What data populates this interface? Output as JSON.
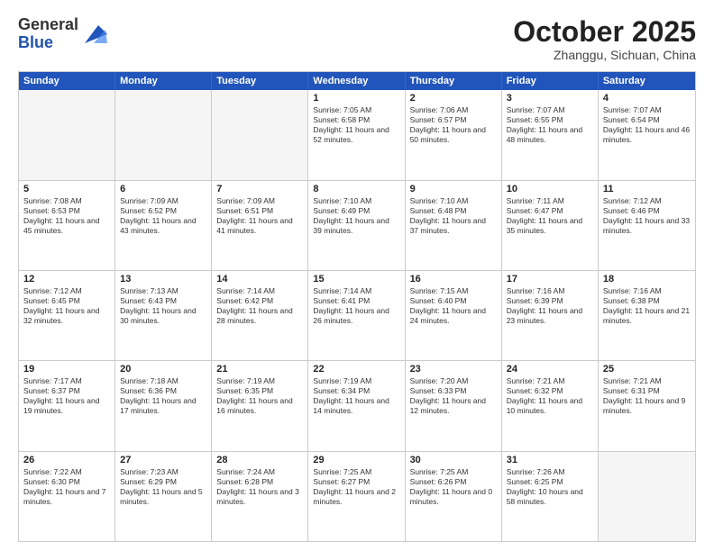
{
  "header": {
    "logo": {
      "general": "General",
      "blue": "Blue"
    },
    "title": "October 2025",
    "location": "Zhanggu, Sichuan, China"
  },
  "calendar": {
    "days_of_week": [
      "Sunday",
      "Monday",
      "Tuesday",
      "Wednesday",
      "Thursday",
      "Friday",
      "Saturday"
    ],
    "rows": [
      [
        {
          "day": "",
          "empty": true
        },
        {
          "day": "",
          "empty": true
        },
        {
          "day": "",
          "empty": true
        },
        {
          "day": "1",
          "sunrise": "7:05 AM",
          "sunset": "6:58 PM",
          "daylight": "11 hours and 52 minutes."
        },
        {
          "day": "2",
          "sunrise": "7:06 AM",
          "sunset": "6:57 PM",
          "daylight": "11 hours and 50 minutes."
        },
        {
          "day": "3",
          "sunrise": "7:07 AM",
          "sunset": "6:55 PM",
          "daylight": "11 hours and 48 minutes."
        },
        {
          "day": "4",
          "sunrise": "7:07 AM",
          "sunset": "6:54 PM",
          "daylight": "11 hours and 46 minutes."
        }
      ],
      [
        {
          "day": "5",
          "sunrise": "7:08 AM",
          "sunset": "6:53 PM",
          "daylight": "11 hours and 45 minutes."
        },
        {
          "day": "6",
          "sunrise": "7:09 AM",
          "sunset": "6:52 PM",
          "daylight": "11 hours and 43 minutes."
        },
        {
          "day": "7",
          "sunrise": "7:09 AM",
          "sunset": "6:51 PM",
          "daylight": "11 hours and 41 minutes."
        },
        {
          "day": "8",
          "sunrise": "7:10 AM",
          "sunset": "6:49 PM",
          "daylight": "11 hours and 39 minutes."
        },
        {
          "day": "9",
          "sunrise": "7:10 AM",
          "sunset": "6:48 PM",
          "daylight": "11 hours and 37 minutes."
        },
        {
          "day": "10",
          "sunrise": "7:11 AM",
          "sunset": "6:47 PM",
          "daylight": "11 hours and 35 minutes."
        },
        {
          "day": "11",
          "sunrise": "7:12 AM",
          "sunset": "6:46 PM",
          "daylight": "11 hours and 33 minutes."
        }
      ],
      [
        {
          "day": "12",
          "sunrise": "7:12 AM",
          "sunset": "6:45 PM",
          "daylight": "11 hours and 32 minutes."
        },
        {
          "day": "13",
          "sunrise": "7:13 AM",
          "sunset": "6:43 PM",
          "daylight": "11 hours and 30 minutes."
        },
        {
          "day": "14",
          "sunrise": "7:14 AM",
          "sunset": "6:42 PM",
          "daylight": "11 hours and 28 minutes."
        },
        {
          "day": "15",
          "sunrise": "7:14 AM",
          "sunset": "6:41 PM",
          "daylight": "11 hours and 26 minutes."
        },
        {
          "day": "16",
          "sunrise": "7:15 AM",
          "sunset": "6:40 PM",
          "daylight": "11 hours and 24 minutes."
        },
        {
          "day": "17",
          "sunrise": "7:16 AM",
          "sunset": "6:39 PM",
          "daylight": "11 hours and 23 minutes."
        },
        {
          "day": "18",
          "sunrise": "7:16 AM",
          "sunset": "6:38 PM",
          "daylight": "11 hours and 21 minutes."
        }
      ],
      [
        {
          "day": "19",
          "sunrise": "7:17 AM",
          "sunset": "6:37 PM",
          "daylight": "11 hours and 19 minutes."
        },
        {
          "day": "20",
          "sunrise": "7:18 AM",
          "sunset": "6:36 PM",
          "daylight": "11 hours and 17 minutes."
        },
        {
          "day": "21",
          "sunrise": "7:19 AM",
          "sunset": "6:35 PM",
          "daylight": "11 hours and 16 minutes."
        },
        {
          "day": "22",
          "sunrise": "7:19 AM",
          "sunset": "6:34 PM",
          "daylight": "11 hours and 14 minutes."
        },
        {
          "day": "23",
          "sunrise": "7:20 AM",
          "sunset": "6:33 PM",
          "daylight": "11 hours and 12 minutes."
        },
        {
          "day": "24",
          "sunrise": "7:21 AM",
          "sunset": "6:32 PM",
          "daylight": "11 hours and 10 minutes."
        },
        {
          "day": "25",
          "sunrise": "7:21 AM",
          "sunset": "6:31 PM",
          "daylight": "11 hours and 9 minutes."
        }
      ],
      [
        {
          "day": "26",
          "sunrise": "7:22 AM",
          "sunset": "6:30 PM",
          "daylight": "11 hours and 7 minutes."
        },
        {
          "day": "27",
          "sunrise": "7:23 AM",
          "sunset": "6:29 PM",
          "daylight": "11 hours and 5 minutes."
        },
        {
          "day": "28",
          "sunrise": "7:24 AM",
          "sunset": "6:28 PM",
          "daylight": "11 hours and 3 minutes."
        },
        {
          "day": "29",
          "sunrise": "7:25 AM",
          "sunset": "6:27 PM",
          "daylight": "11 hours and 2 minutes."
        },
        {
          "day": "30",
          "sunrise": "7:25 AM",
          "sunset": "6:26 PM",
          "daylight": "11 hours and 0 minutes."
        },
        {
          "day": "31",
          "sunrise": "7:26 AM",
          "sunset": "6:25 PM",
          "daylight": "10 hours and 58 minutes."
        },
        {
          "day": "",
          "empty": true
        }
      ]
    ]
  }
}
